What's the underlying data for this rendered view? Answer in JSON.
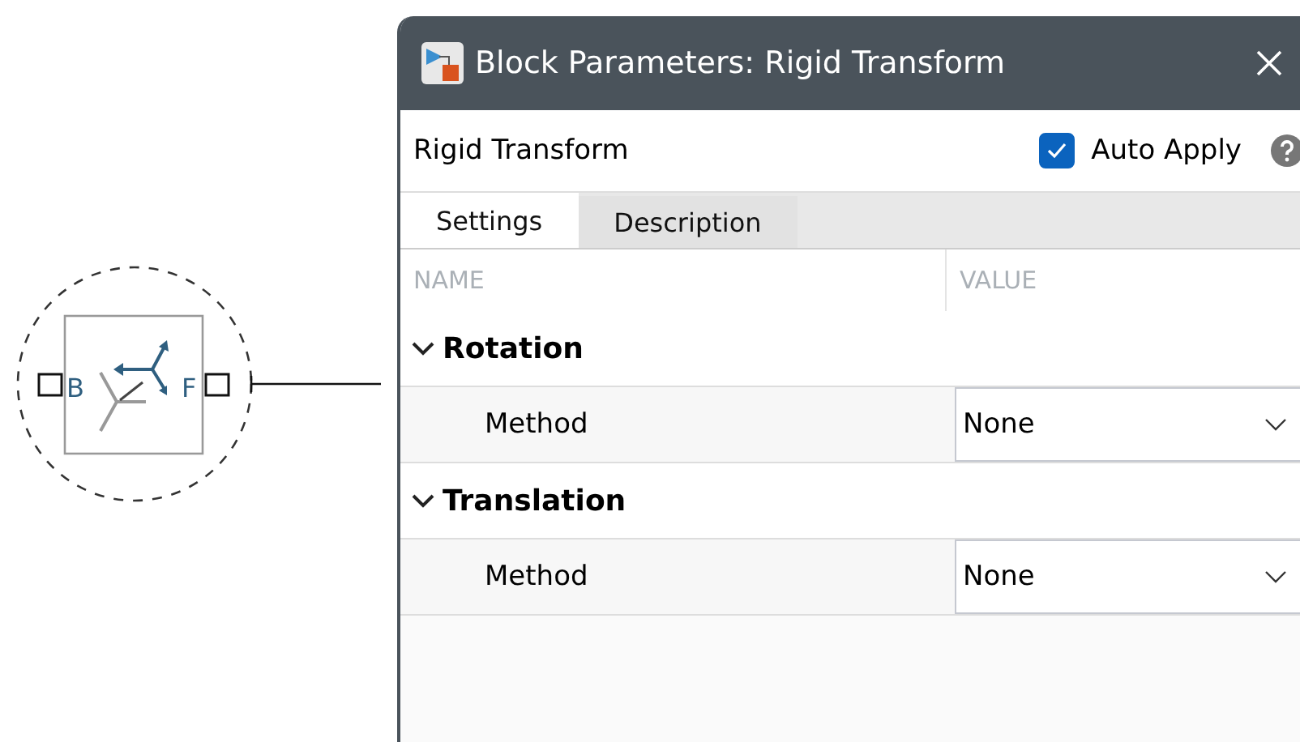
{
  "block": {
    "port_labels": [
      "B",
      "F"
    ]
  },
  "dialog": {
    "title": "Block Parameters: Rigid Transform",
    "block_name": "Rigid Transform",
    "auto_apply": {
      "label": "Auto Apply",
      "checked": true
    },
    "tabs": [
      {
        "label": "Settings",
        "selected": true
      },
      {
        "label": "Description",
        "selected": false
      }
    ],
    "columns": [
      "NAME",
      "VALUE"
    ],
    "groups": [
      {
        "label": "Rotation",
        "expanded": true,
        "params": [
          {
            "name": "Method",
            "value": "None"
          }
        ]
      },
      {
        "label": "Translation",
        "expanded": true,
        "params": [
          {
            "name": "Method",
            "value": "None"
          }
        ]
      }
    ]
  }
}
